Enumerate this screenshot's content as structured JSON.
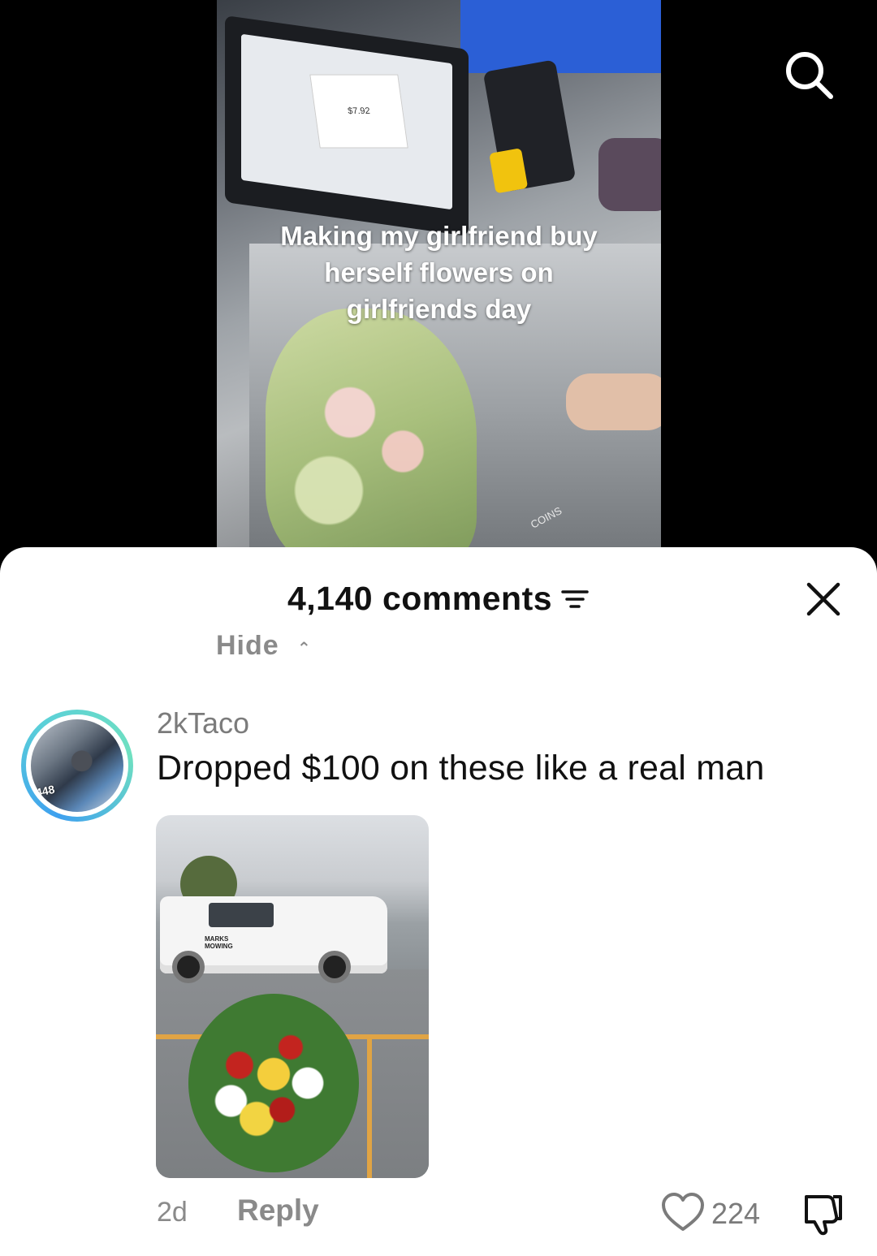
{
  "video": {
    "caption": "Making my girlfriend buy\nherself flowers on\ngirlfriends day",
    "screen_price": "$7.92",
    "coin_slot_label": "COINS"
  },
  "top_bar": {
    "search_icon": "search-icon"
  },
  "comments_sheet": {
    "title": "4,140 comments",
    "filter_icon": "filter-icon",
    "close_icon": "close-icon",
    "hide_label": "Hide",
    "comment": {
      "username": "2kTaco",
      "text": "Dropped $100 on these like a real man",
      "time": "2d",
      "reply_label": "Reply",
      "like_count": "224",
      "truck_sign": "MARKS MOWING"
    }
  },
  "colors": {
    "sheet_bg": "#ffffff",
    "muted_text": "#8a8a8a",
    "primary_text": "#111111",
    "avatar_ring_start": "#3ea0ef",
    "avatar_ring_end": "#6fe0c0"
  }
}
